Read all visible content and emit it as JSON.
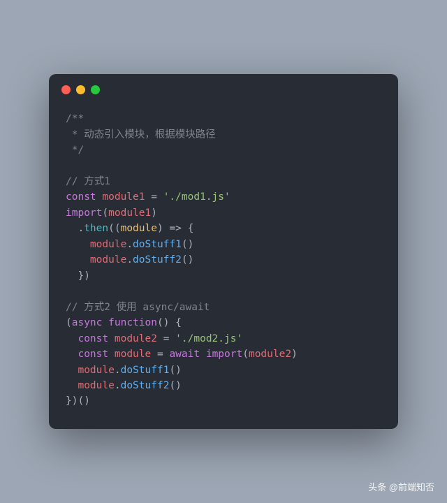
{
  "window": {
    "dots": [
      "red",
      "yellow",
      "green"
    ]
  },
  "code": {
    "block_comment_open": "/**",
    "block_comment_line": " * 动态引入模块，根据模块路径",
    "block_comment_close": " */",
    "comment1": "// 方式1",
    "kw_const": "const",
    "var_module1": "module1",
    "eq": " = ",
    "str_mod1": "'./mod1.js'",
    "kw_import": "import",
    "paren_open": "(",
    "paren_close": ")",
    "dot": ".",
    "fn_then": "then",
    "param_module": "module",
    "arrow": " => {",
    "indent2": "  ",
    "indent4": "    ",
    "method_doStuff1": "doStuff1",
    "method_doStuff2": "doStuff2",
    "empty_call": "()",
    "brace_close_paren": "})",
    "blank": "",
    "comment2": "// 方式2 使用 async/await",
    "kw_async": "async",
    "kw_function": "function",
    "fn_anon_open": "() {",
    "var_module2": "module2",
    "str_mod2": "'./mod2.js'",
    "var_module": "module",
    "kw_await": "await",
    "iife_close": "})()"
  },
  "watermark": "头条 @前端知否"
}
